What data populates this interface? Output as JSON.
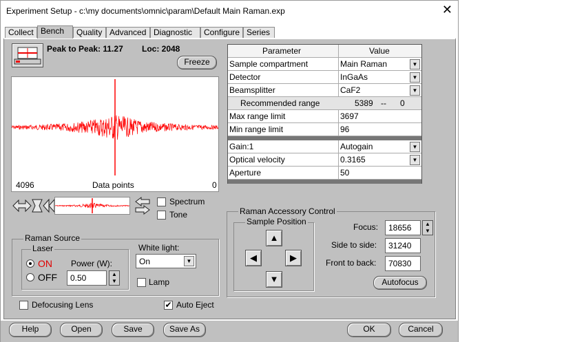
{
  "window": {
    "title": "Experiment Setup - c:\\my documents\\omnic\\param\\Default Main Raman.exp"
  },
  "tabs": [
    {
      "label": "Collect"
    },
    {
      "label": "Bench",
      "active": true
    },
    {
      "label": "Quality"
    },
    {
      "label": "Advanced"
    },
    {
      "label": "Diagnostic"
    },
    {
      "label": "Configure"
    },
    {
      "label": "Series"
    }
  ],
  "signal": {
    "peak_label": "Peak to Peak: 11.27",
    "loc_label": "Loc: 2048",
    "freeze_label": "Freeze"
  },
  "graph": {
    "left_label": "4096",
    "center_label": "Data points",
    "right_label": "0",
    "trace_color": "#ff0000"
  },
  "display": {
    "spectrum_label": "Spectrum",
    "spectrum_checked": false,
    "tone_label": "Tone",
    "tone_checked": false
  },
  "params": {
    "header_param": "Parameter",
    "header_value": "Value",
    "rows1": [
      {
        "param": "Sample compartment",
        "value": "Main Raman",
        "dropdown": true
      },
      {
        "param": "Detector",
        "value": "InGaAs",
        "dropdown": true
      },
      {
        "param": "Beamsplitter",
        "value": "CaF2",
        "dropdown": true
      }
    ],
    "recommended": {
      "label": "Recommended range",
      "from": "5389",
      "sep": "--",
      "to": "0"
    },
    "rows2": [
      {
        "param": "Max range limit",
        "value": "3697",
        "dropdown": false
      },
      {
        "param": "Min range limit",
        "value": "96",
        "dropdown": false
      }
    ],
    "rows3": [
      {
        "param": "Gain:1",
        "value": "Autogain",
        "dropdown": true
      },
      {
        "param": "Optical velocity",
        "value": "0.3165",
        "dropdown": true
      },
      {
        "param": "Aperture",
        "value": "50",
        "dropdown": false
      }
    ]
  },
  "raman_source": {
    "title": "Raman Source",
    "laser_title": "Laser",
    "on_label": "ON",
    "off_label": "OFF",
    "on_selected": true,
    "on_color": "#e00000",
    "power_label": "Power (W):",
    "power_value": "0.50",
    "white_light_label": "White light:",
    "white_light_value": "On",
    "lamp_label": "Lamp",
    "lamp_checked": false
  },
  "accessory": {
    "title": "Raman Accessory Control",
    "sample_position_title": "Sample Position",
    "focus_label": "Focus:",
    "focus_value": "18656",
    "side_label": "Side to side:",
    "side_value": "31240",
    "front_label": "Front to back:",
    "front_value": "70830",
    "autofocus_label": "Autofocus"
  },
  "options": {
    "defocusing_label": "Defocusing Lens",
    "defocusing_checked": false,
    "auto_eject_label": "Auto Eject",
    "auto_eject_checked": true
  },
  "buttons": {
    "help": "Help",
    "open": "Open",
    "save": "Save",
    "save_as": "Save As",
    "ok": "OK",
    "cancel": "Cancel"
  }
}
